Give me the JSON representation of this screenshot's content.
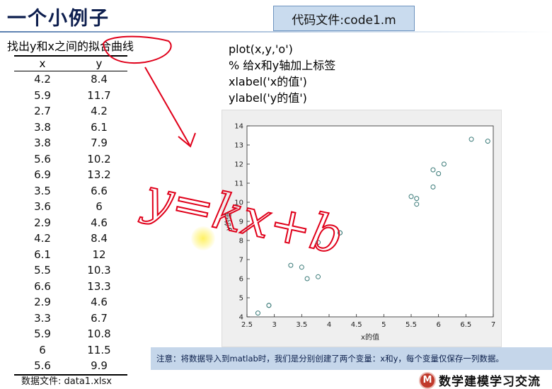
{
  "slide": {
    "title": "一个小例子",
    "code_file_label": "代码文件:code1.m",
    "subtitle": "找出y和x之间的拟合曲线"
  },
  "table": {
    "headers": [
      "x",
      "y"
    ],
    "rows": [
      [
        "4.2",
        "8.4"
      ],
      [
        "5.9",
        "11.7"
      ],
      [
        "2.7",
        "4.2"
      ],
      [
        "3.8",
        "6.1"
      ],
      [
        "3.8",
        "7.9"
      ],
      [
        "5.6",
        "10.2"
      ],
      [
        "6.9",
        "13.2"
      ],
      [
        "3.5",
        "6.6"
      ],
      [
        "3.6",
        "6"
      ],
      [
        "2.9",
        "4.6"
      ],
      [
        "4.2",
        "8.4"
      ],
      [
        "6.1",
        "12"
      ],
      [
        "5.5",
        "10.3"
      ],
      [
        "6.6",
        "13.3"
      ],
      [
        "2.9",
        "4.6"
      ],
      [
        "3.3",
        "6.7"
      ],
      [
        "5.9",
        "10.8"
      ],
      [
        "6",
        "11.5"
      ],
      [
        "5.6",
        "9.9"
      ]
    ]
  },
  "data_file_label": "数据文件: data1.xlsx",
  "code_lines": [
    "plot(x,y,'o')",
    "% 给x和y轴加上标签",
    "xlabel('x的值')",
    "ylabel('y的值')"
  ],
  "handwriting": "y=kx+b",
  "note": "注意：将数据导入到matlab时，我们是分别创建了两个变量：x和y，每个变量仅保存一列数据。",
  "brand": {
    "logo_letter": "M",
    "name": "数学建模学习交流"
  },
  "colors": {
    "title": "#0d1e4e",
    "code_box": "#c9dbee",
    "note_bar": "#c5d6ea",
    "ink": "#e0001a",
    "marker": "#3a7a78"
  },
  "chart_data": {
    "type": "scatter",
    "xlabel": "x的值",
    "ylabel": "y的值",
    "xlim": [
      2.5,
      7
    ],
    "ylim": [
      4,
      14
    ],
    "xticks": [
      "2.5",
      "3",
      "3.5",
      "4",
      "4.5",
      "5",
      "5.5",
      "6",
      "6.5",
      "7"
    ],
    "yticks": [
      "4",
      "5",
      "6",
      "7",
      "8",
      "9",
      "10",
      "11",
      "12",
      "13",
      "14"
    ],
    "marker": "o",
    "x": [
      4.2,
      5.9,
      2.7,
      3.8,
      3.8,
      5.6,
      6.9,
      3.5,
      3.6,
      2.9,
      4.2,
      6.1,
      5.5,
      6.6,
      2.9,
      3.3,
      5.9,
      6.0,
      5.6
    ],
    "y": [
      8.4,
      11.7,
      4.2,
      6.1,
      7.9,
      10.2,
      13.2,
      6.6,
      6.0,
      4.6,
      8.4,
      12.0,
      10.3,
      13.3,
      4.6,
      6.7,
      10.8,
      11.5,
      9.9
    ]
  }
}
